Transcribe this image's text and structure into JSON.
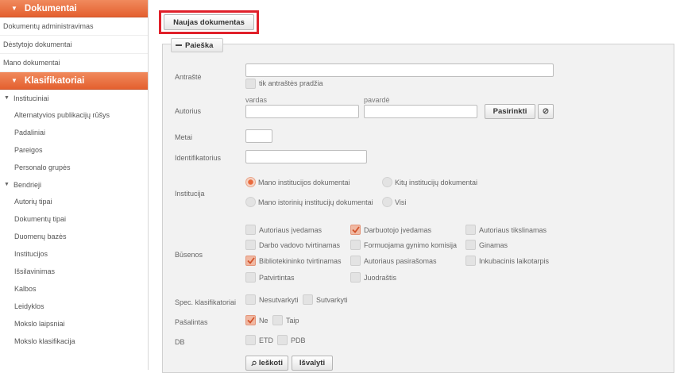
{
  "sidebar": {
    "dokumentai": {
      "title": "Dokumentai",
      "items": [
        "Dokumentų administravimas",
        "Dėstytojo dokumentai",
        "Mano dokumentai"
      ]
    },
    "klasifikatoriai": {
      "title": "Klasifikatoriai",
      "groups": [
        {
          "title": "Instituciniai",
          "items": [
            "Alternatyvios publikacijų rūšys",
            "Padaliniai",
            "Pareigos",
            "Personalo grupės"
          ]
        },
        {
          "title": "Bendrieji",
          "items": [
            "Autorių tipai",
            "Dokumentų tipai",
            "Duomenų bazės",
            "Institucijos",
            "Išsilavinimas",
            "Kalbos",
            "Leidyklos",
            "Mokslo laipsniai",
            "Mokslo klasifikacija"
          ]
        }
      ]
    }
  },
  "toolbar": {
    "new_doc_label": "Naujas dokumentas"
  },
  "search": {
    "tab_label": "Paieška",
    "antraste": {
      "label": "Antraštė",
      "value": "",
      "starts_with_label": "tik antraštės pradžia"
    },
    "autorius": {
      "label": "Autorius",
      "first_name_label": "vardas",
      "last_name_label": "pavardė",
      "choose_label": "Pasirinkti",
      "clear_icon": "⊘"
    },
    "metai": {
      "label": "Metai"
    },
    "identifikatorius": {
      "label": "Identifikatorius"
    },
    "institucija": {
      "label": "Institucija",
      "options": [
        "Mano institucijos dokumentai",
        "Kitų institucijų dokumentai",
        "Mano istorinių institucijų dokumentai",
        "Visi"
      ]
    },
    "busenos": {
      "label": "Būsenos",
      "options": [
        "Autoriaus įvedamas",
        "Darbuotojo įvedamas",
        "Autoriaus tikslinamas",
        "Darbo vadovo tvirtinamas",
        "Formuojama gynimo komisija",
        "Ginamas",
        "Bibliotekininko tvirtinamas",
        "Autoriaus pasirašomas",
        "Inkubacinis laikotarpis",
        "Patvirtintas",
        "Juodraštis"
      ]
    },
    "spec": {
      "label": "Spec. klasifikatoriai",
      "options": [
        "Nesutvarkyti",
        "Sutvarkyti"
      ]
    },
    "pasalintas": {
      "label": "Pašalintas",
      "options": [
        "Ne",
        "Taip"
      ]
    },
    "db": {
      "label": "DB",
      "options": [
        "ETD",
        "PDB"
      ]
    },
    "search_btn": "Ieškoti",
    "clear_btn": "Išvalyti"
  },
  "colors": {
    "accent": "#e4602f",
    "highlight_border": "#e0202a"
  }
}
